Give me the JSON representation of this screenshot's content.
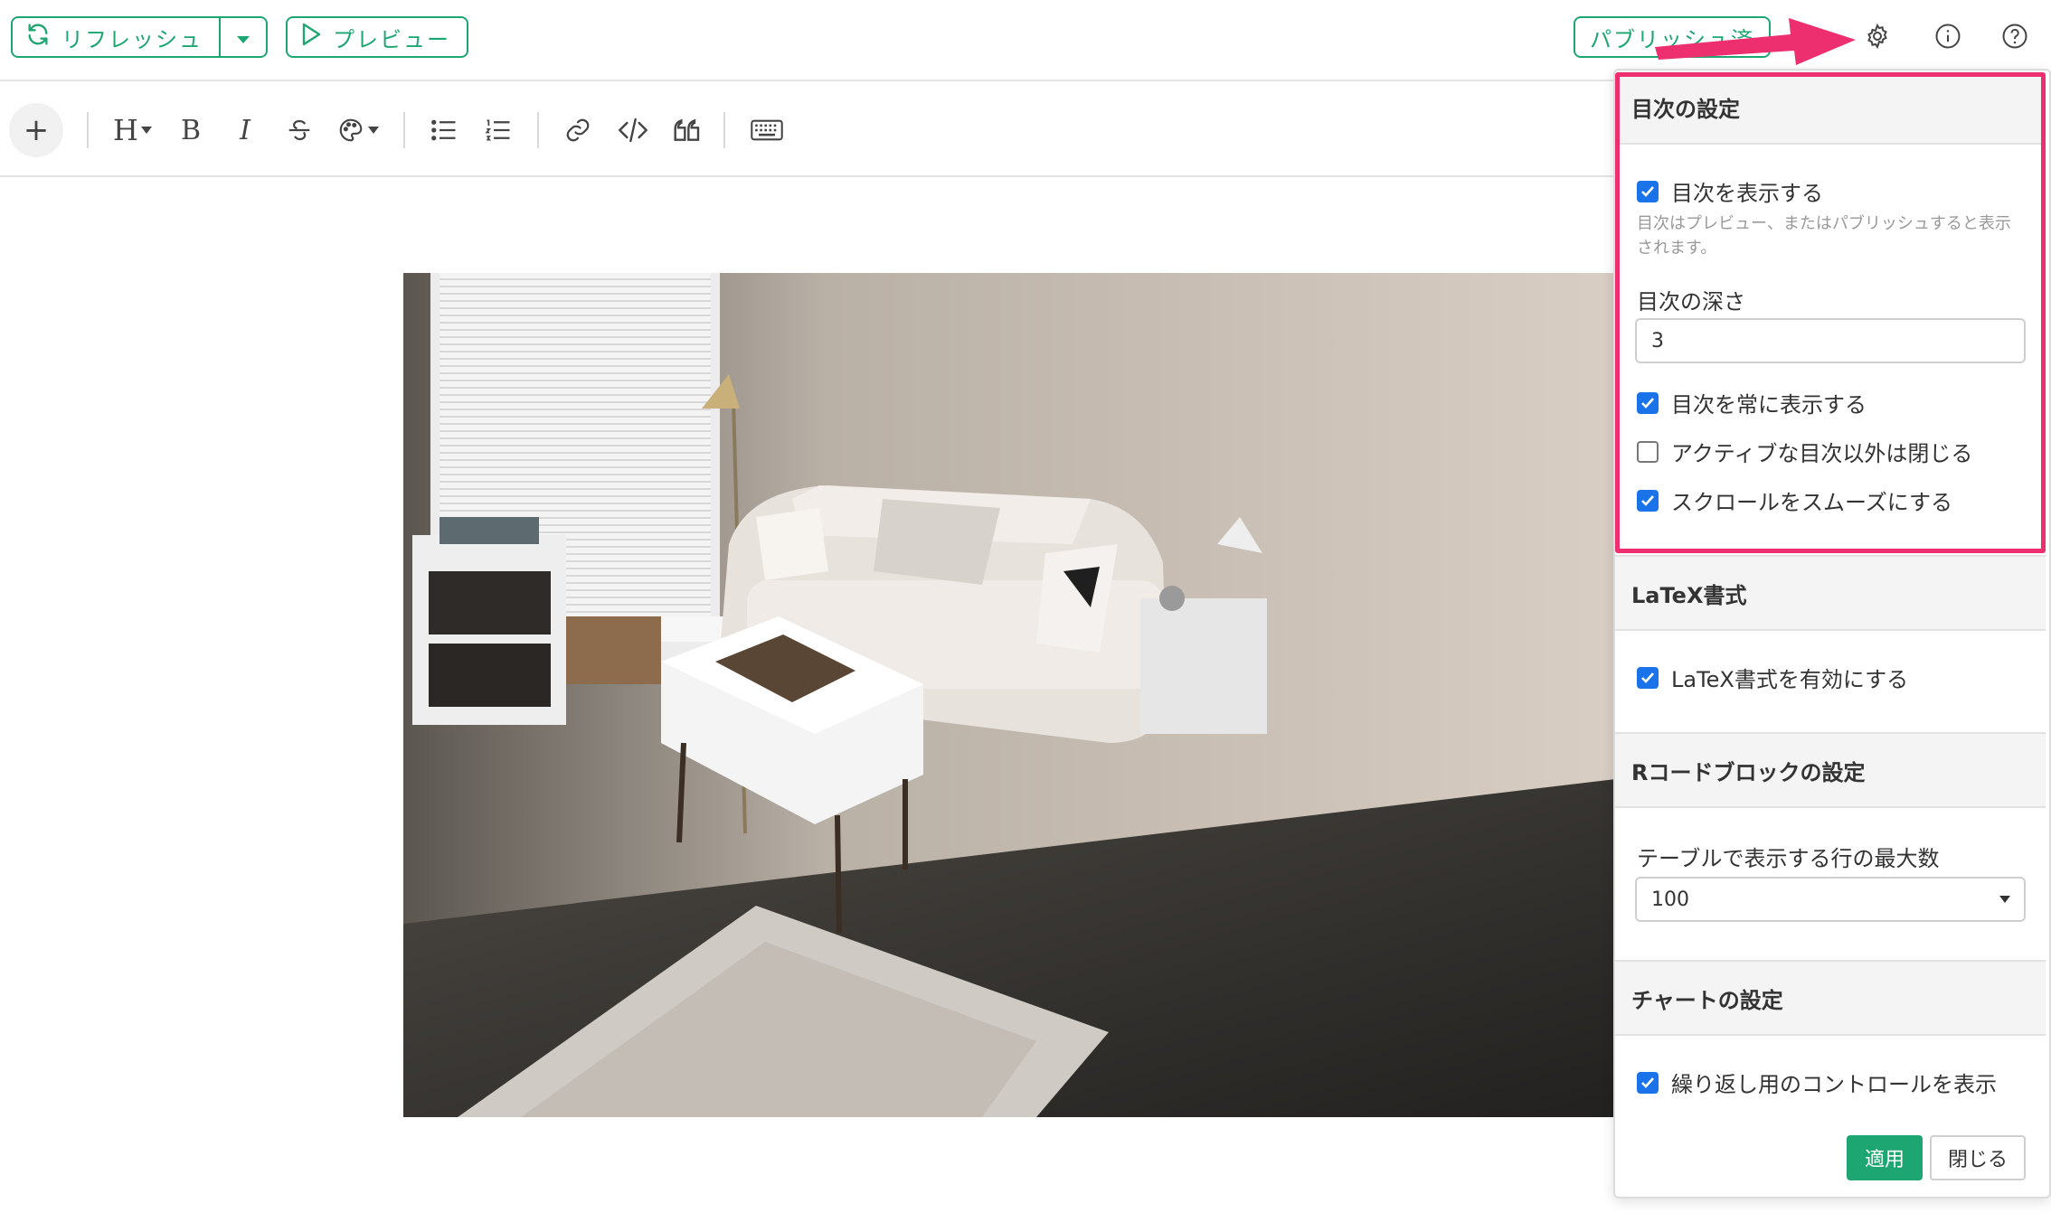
{
  "topbar": {
    "refresh_label": "リフレッシュ",
    "preview_label": "プレビュー",
    "publish_label": "パブリッシュ済"
  },
  "icons": {
    "settings": "gear-icon",
    "info": "info-icon",
    "help": "help-icon"
  },
  "toolbar": {
    "add": "+",
    "heading": "H",
    "bold": "B",
    "italic": "I"
  },
  "panel": {
    "toc": {
      "title": "目次の設定",
      "show_toc": {
        "label": "目次を表示する",
        "checked": true
      },
      "hint": "目次はプレビュー、またはパブリッシュすると表示されます。",
      "depth_label": "目次の深さ",
      "depth_value": "3",
      "always_show": {
        "label": "目次を常に表示する",
        "checked": true
      },
      "collapse_inactive": {
        "label": "アクティブな目次以外は閉じる",
        "checked": false
      },
      "smooth_scroll": {
        "label": "スクロールをスムーズにする",
        "checked": true
      }
    },
    "latex": {
      "title": "LaTeX書式",
      "enable": {
        "label": "LaTeX書式を有効にする",
        "checked": true
      }
    },
    "rcode": {
      "title": "Rコードブロックの設定",
      "max_rows_label": "テーブルで表示する行の最大数",
      "max_rows_value": "100"
    },
    "chart": {
      "title": "チャートの設定",
      "repeat_controls": {
        "label": "繰り返し用のコントロールを表示",
        "checked": true
      }
    },
    "apply_label": "適用",
    "close_label": "閉じる"
  },
  "colors": {
    "accent_green": "#1ea672",
    "checkbox_blue": "#1a73e8",
    "highlight_pink": "#ee2f6f"
  }
}
